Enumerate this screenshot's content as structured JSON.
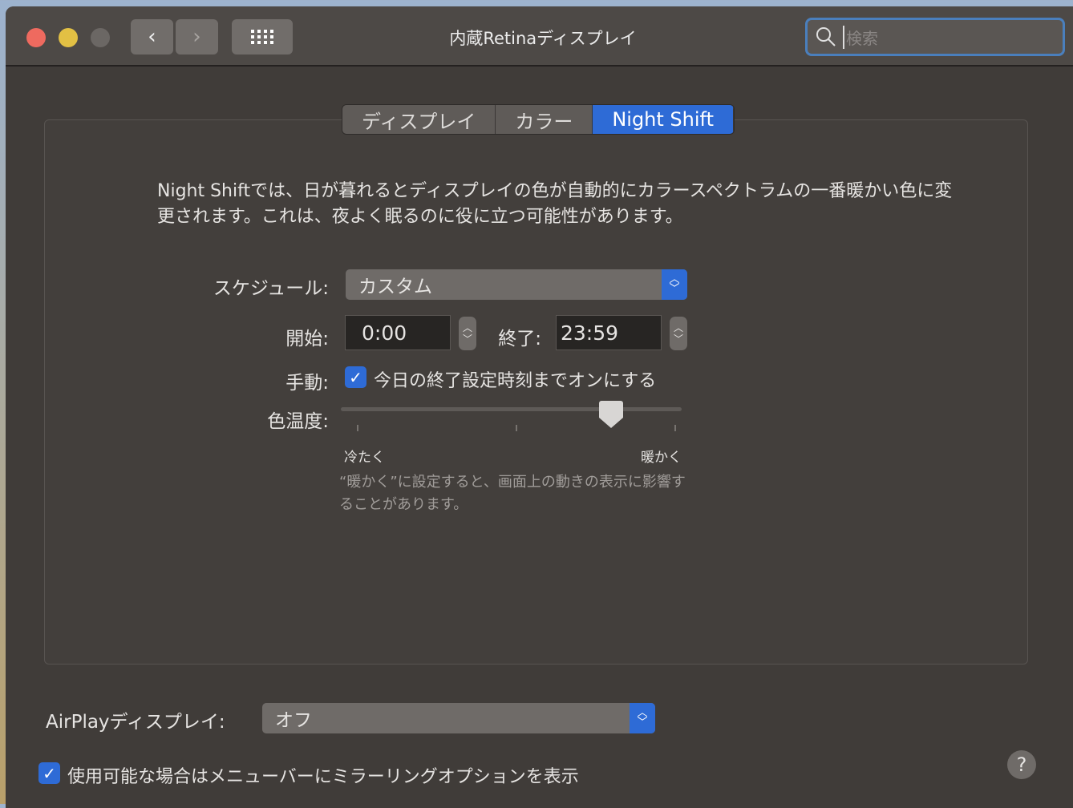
{
  "window": {
    "title": "内蔵Retinaディスプレイ",
    "search_placeholder": "検索"
  },
  "tabs": [
    {
      "label": "ディスプレイ"
    },
    {
      "label": "カラー"
    },
    {
      "label": "Night Shift",
      "active": true
    }
  ],
  "description": "Night Shiftでは、日が暮れるとディスプレイの色が自動的にカラースペクトラムの一番暖かい色に変更されます。これは、夜よく眠るのに役に立つ可能性があります。",
  "schedule": {
    "label": "スケジュール:",
    "value": "カスタム"
  },
  "start": {
    "label": "開始:",
    "value": "0:00"
  },
  "end": {
    "label": "終了:",
    "value": "23:59"
  },
  "manual": {
    "label": "手動:",
    "checkbox_label": "今日の終了設定時刻までオンにする",
    "checked": true
  },
  "temperature": {
    "label": "色温度:",
    "min_label": "冷たく",
    "max_label": "暖かく",
    "value": 0.79,
    "note": "“暖かく”に設定すると、画面上の動きの表示に影響することがあります。"
  },
  "airplay": {
    "label": "AirPlayディスプレイ:",
    "value": "オフ"
  },
  "mirroring": {
    "label": "使用可能な場合はメニューバーにミラーリングオプションを表示",
    "checked": true
  },
  "help_label": "?",
  "colors": {
    "accent": "#2e6bd6",
    "close": "#ee6a5f",
    "minimize": "#e2c044",
    "zoom": "#6b6764"
  }
}
